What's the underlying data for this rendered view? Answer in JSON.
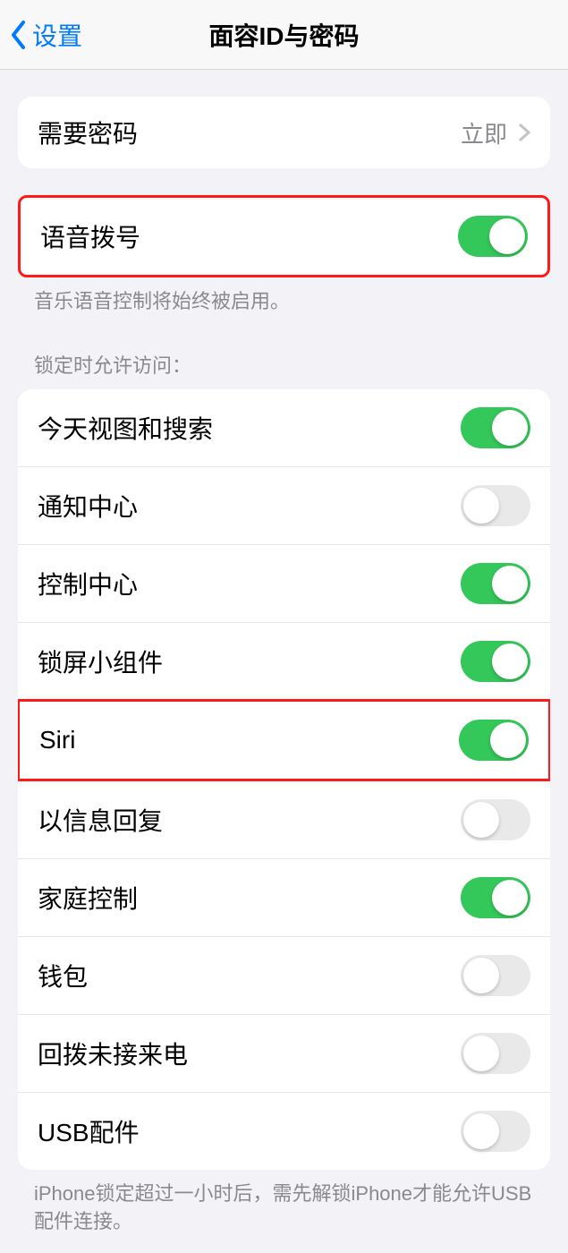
{
  "header": {
    "back_label": "设置",
    "title": "面容ID与密码"
  },
  "require_passcode": {
    "label": "需要密码",
    "value": "立即"
  },
  "voice_dial": {
    "label": "语音拨号",
    "on": true,
    "footer": "音乐语音控制将始终被启用。"
  },
  "lock_allow_header": "锁定时允许访问：",
  "lock_items": [
    {
      "label": "今天视图和搜索",
      "on": true
    },
    {
      "label": "通知中心",
      "on": false
    },
    {
      "label": "控制中心",
      "on": true
    },
    {
      "label": "锁屏小组件",
      "on": true
    },
    {
      "label": "Siri",
      "on": true,
      "highlighted": true
    },
    {
      "label": "以信息回复",
      "on": false
    },
    {
      "label": "家庭控制",
      "on": true
    },
    {
      "label": "钱包",
      "on": false
    },
    {
      "label": "回拨未接来电",
      "on": false
    },
    {
      "label": "USB配件",
      "on": false
    }
  ],
  "usb_footer": "iPhone锁定超过一小时后，需先解锁iPhone才能允许USB 配件连接。"
}
